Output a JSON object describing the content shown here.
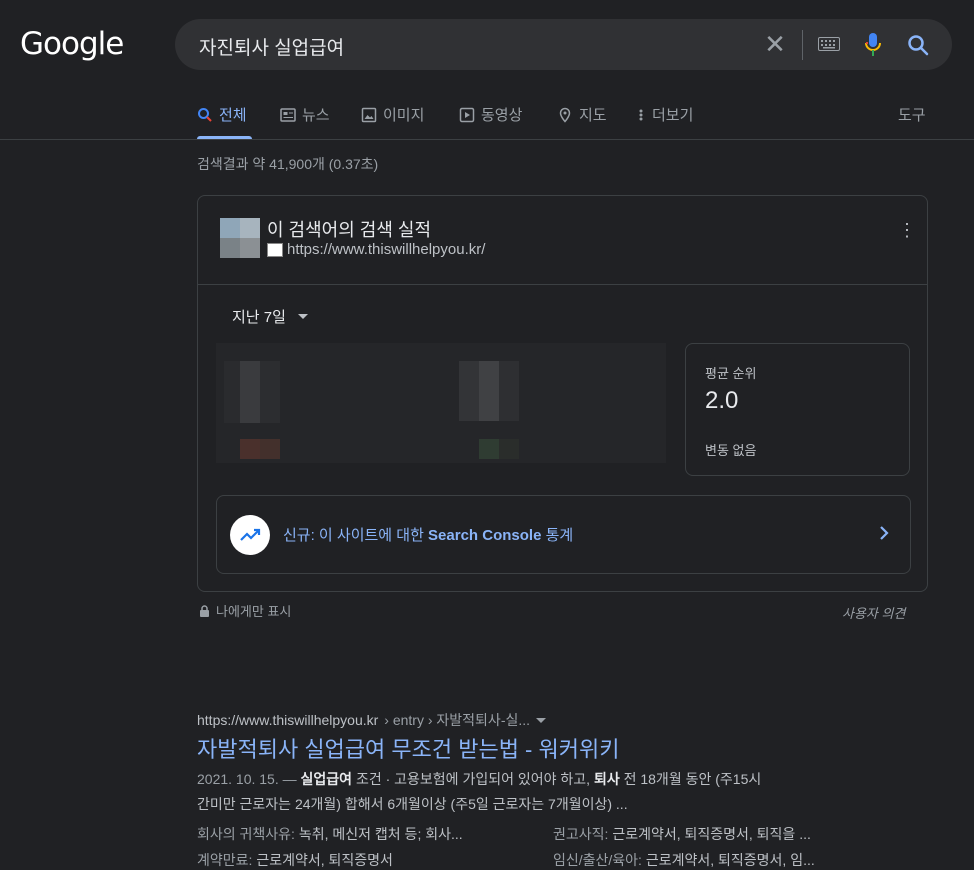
{
  "logo": "Google",
  "search": {
    "query": "자진퇴사 실업급여"
  },
  "tabs": [
    {
      "label": "전체",
      "icon": "search-icon"
    },
    {
      "label": "뉴스",
      "icon": "news-icon"
    },
    {
      "label": "이미지",
      "icon": "image-icon"
    },
    {
      "label": "동영상",
      "icon": "video-icon"
    },
    {
      "label": "지도",
      "icon": "map-pin-icon"
    },
    {
      "label": "더보기",
      "icon": "more-vert-icon"
    }
  ],
  "tools_label": "도구",
  "result_stats": "검색결과 약 41,900개 (0.37초)",
  "card": {
    "title": "이 검색어의 검색 실적",
    "url": "https://www.thiswillhelpyou.kr/",
    "period": "지난 7일",
    "rank_label": "평균 순위",
    "rank_value": "2.0",
    "rank_change": "변동 없음",
    "console_prefix": "신규: 이 사이트에 대한 ",
    "console_bold": "Search Console",
    "console_suffix": " 통계"
  },
  "private_label": "나에게만 표시",
  "feedback_label": "사용자 의견",
  "result": {
    "url": "https://www.thiswillhelpyou.kr",
    "path": "› entry › 자발적퇴사-실...",
    "title": "자발적퇴사 실업급여 무조건 받는법 - 워커위키",
    "date": "2021. 10. 15. —",
    "s1": "실업급여",
    "s2": "조건 · 고용보험에 가입되어 있어야 하고,",
    "s3": "퇴사",
    "s4": "전 18개월 동안 (주15시",
    "line2": "간미만 근로자는 24개월) 합해서 6개월이상 (주5일 근로자는 7개월이상) ...",
    "links": [
      {
        "key": "회사의 귀책사유:",
        "value": "녹취, 메신저 캡처 등; 회사..."
      },
      {
        "key": "권고사직:",
        "value": "근로계약서, 퇴직증명서, 퇴직을 ..."
      },
      {
        "key": "계약만료:",
        "value": "근로계약서, 퇴직증명서"
      },
      {
        "key": "임신/출산/육아:",
        "value": "근로계약서, 퇴직증명서, 임..."
      }
    ]
  },
  "colors": {
    "background": "#202124",
    "link": "#8ab4f8",
    "text": "#bdc1c6"
  }
}
